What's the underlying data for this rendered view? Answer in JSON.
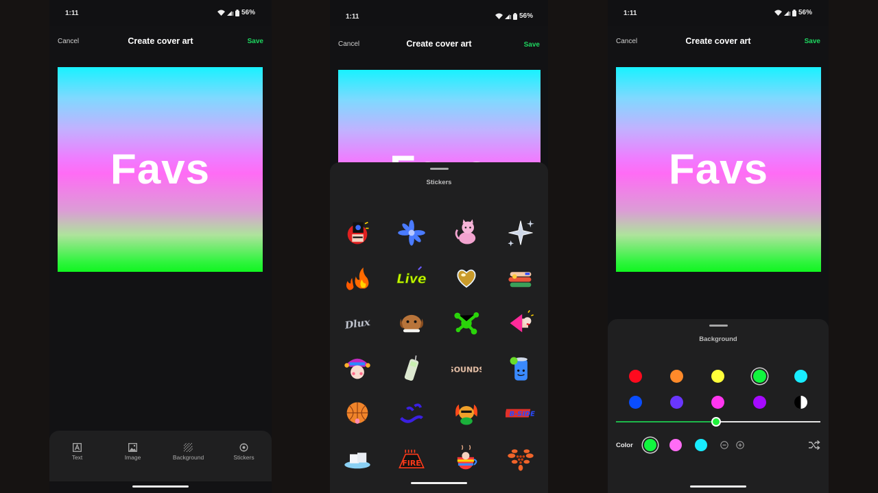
{
  "status_bar": {
    "time": "1:11",
    "battery": "56%"
  },
  "header": {
    "cancel_label": "Cancel",
    "title": "Create cover art",
    "save_label": "Save"
  },
  "cover": {
    "text": "Favs",
    "gradient_colors": [
      "#18f2ff",
      "#ff6cf5",
      "#10f520"
    ]
  },
  "bottom_nav": {
    "items": [
      {
        "label": "Text",
        "icon": "text-icon"
      },
      {
        "label": "Image",
        "icon": "image-icon"
      },
      {
        "label": "Background",
        "icon": "background-icon"
      },
      {
        "label": "Stickers",
        "icon": "sticker-icon"
      }
    ]
  },
  "stickers_sheet": {
    "title": "Stickers",
    "stickers": [
      "boombox-head-sticker",
      "blue-flower-sticker",
      "pink-cat-sticker",
      "sparkles-sticker",
      "fire-sticker",
      "live-text-sticker",
      "golden-heart-sticker",
      "hands-sticker",
      "chrome-script-sticker",
      "angry-dog-sticker",
      "green-splat-sticker",
      "megaphone-sticker",
      "jester-sticker",
      "retro-phone-sticker",
      "sounds-text-sticker",
      "soda-can-sticker",
      "basketball-face-sticker",
      "blue-wave-sticker",
      "flaming-bear-sticker",
      "b-side-sticker",
      "sugar-cubes-sticker",
      "fire-text-sticker",
      "coffee-cup-sticker",
      "orange-pattern-sticker"
    ]
  },
  "background_sheet": {
    "title": "Background",
    "swatches": [
      {
        "name": "red",
        "color": "#ff0a1e"
      },
      {
        "name": "orange",
        "color": "#ff8a2a"
      },
      {
        "name": "yellow",
        "color": "#ffff3a"
      },
      {
        "name": "green",
        "color": "#10f53e",
        "selected": true
      },
      {
        "name": "cyan",
        "color": "#18ecff"
      },
      {
        "name": "blue",
        "color": "#0a4dff"
      },
      {
        "name": "indigo",
        "color": "#6a36ff"
      },
      {
        "name": "magenta",
        "color": "#ff36f0"
      },
      {
        "name": "purple",
        "color": "#a60aff"
      },
      {
        "name": "black-white",
        "color": "bw"
      }
    ],
    "slider_value_percent": 49,
    "color_label": "Color",
    "gradient_stops": [
      {
        "color": "#10f53e",
        "selected": true
      },
      {
        "color": "#ff6cf5"
      },
      {
        "color": "#18ecff"
      }
    ]
  },
  "colors": {
    "accent": "#1ed760",
    "sheet_bg": "#1f1f20",
    "app_bg": "#121214"
  }
}
